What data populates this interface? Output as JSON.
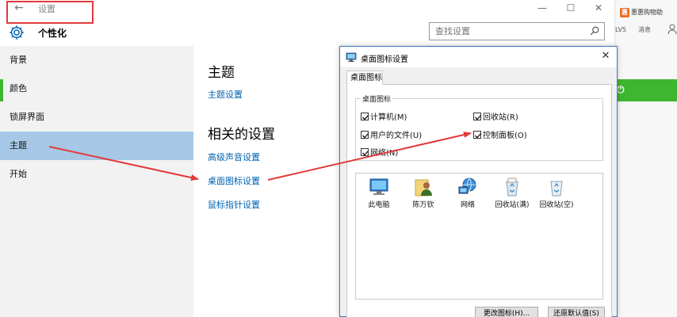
{
  "window": {
    "back": "←",
    "title": "设置",
    "minimize": "—",
    "maximize": "☐",
    "close": "✕"
  },
  "header": {
    "section_title": "个性化",
    "search_placeholder": "查找设置"
  },
  "sidebar": {
    "items": [
      {
        "label": "背景"
      },
      {
        "label": "颜色"
      },
      {
        "label": "锁屏界面"
      },
      {
        "label": "主题",
        "active": true
      },
      {
        "label": "开始"
      }
    ]
  },
  "main": {
    "theme_heading": "主题",
    "theme_link": "主题设置",
    "related_heading": "相关的设置",
    "related_links": [
      "高级声音设置",
      "桌面图标设置",
      "鼠标指针设置"
    ]
  },
  "browser": {
    "bookmark": "惠惠购物助",
    "level": "LV5",
    "messages": "消息"
  },
  "dialog": {
    "title": "桌面图标设置",
    "close": "✕",
    "tab": "桌面图标",
    "group_label": "桌面图标",
    "checkboxes": [
      {
        "label": "计算机(M)",
        "checked": true
      },
      {
        "label": "回收站(R)",
        "checked": true
      },
      {
        "label": "用户的文件(U)",
        "checked": true
      },
      {
        "label": "控制面板(O)",
        "checked": true
      },
      {
        "label": "网络(N)",
        "checked": true
      }
    ],
    "icons": [
      "此电脑",
      "陈万钦",
      "网络",
      "回收站(满)",
      "回收站(空)"
    ],
    "change_icon_button": "更改图标(H)...",
    "restore_default_button": "还原默认值(S)"
  },
  "colors": {
    "accent": "#0063b1",
    "sidebar_active": "#a6c8e6",
    "annotation_red": "#e23a3a",
    "browser_green": "#3eb62f"
  }
}
